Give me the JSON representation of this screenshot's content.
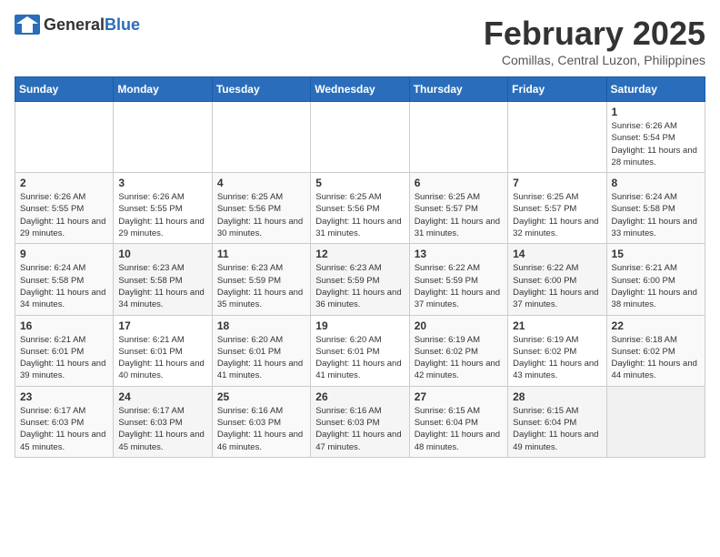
{
  "header": {
    "logo_general": "General",
    "logo_blue": "Blue",
    "month_year": "February 2025",
    "location": "Comillas, Central Luzon, Philippines"
  },
  "weekdays": [
    "Sunday",
    "Monday",
    "Tuesday",
    "Wednesday",
    "Thursday",
    "Friday",
    "Saturday"
  ],
  "weeks": [
    [
      {
        "day": "",
        "sunrise": "",
        "sunset": "",
        "daylight": ""
      },
      {
        "day": "",
        "sunrise": "",
        "sunset": "",
        "daylight": ""
      },
      {
        "day": "",
        "sunrise": "",
        "sunset": "",
        "daylight": ""
      },
      {
        "day": "",
        "sunrise": "",
        "sunset": "",
        "daylight": ""
      },
      {
        "day": "",
        "sunrise": "",
        "sunset": "",
        "daylight": ""
      },
      {
        "day": "",
        "sunrise": "",
        "sunset": "",
        "daylight": ""
      },
      {
        "day": "1",
        "sunrise": "6:26 AM",
        "sunset": "5:54 PM",
        "daylight": "11 hours and 28 minutes."
      }
    ],
    [
      {
        "day": "2",
        "sunrise": "6:26 AM",
        "sunset": "5:55 PM",
        "daylight": "11 hours and 29 minutes."
      },
      {
        "day": "3",
        "sunrise": "6:26 AM",
        "sunset": "5:55 PM",
        "daylight": "11 hours and 29 minutes."
      },
      {
        "day": "4",
        "sunrise": "6:25 AM",
        "sunset": "5:56 PM",
        "daylight": "11 hours and 30 minutes."
      },
      {
        "day": "5",
        "sunrise": "6:25 AM",
        "sunset": "5:56 PM",
        "daylight": "11 hours and 31 minutes."
      },
      {
        "day": "6",
        "sunrise": "6:25 AM",
        "sunset": "5:57 PM",
        "daylight": "11 hours and 31 minutes."
      },
      {
        "day": "7",
        "sunrise": "6:25 AM",
        "sunset": "5:57 PM",
        "daylight": "11 hours and 32 minutes."
      },
      {
        "day": "8",
        "sunrise": "6:24 AM",
        "sunset": "5:58 PM",
        "daylight": "11 hours and 33 minutes."
      }
    ],
    [
      {
        "day": "9",
        "sunrise": "6:24 AM",
        "sunset": "5:58 PM",
        "daylight": "11 hours and 34 minutes."
      },
      {
        "day": "10",
        "sunrise": "6:23 AM",
        "sunset": "5:58 PM",
        "daylight": "11 hours and 34 minutes."
      },
      {
        "day": "11",
        "sunrise": "6:23 AM",
        "sunset": "5:59 PM",
        "daylight": "11 hours and 35 minutes."
      },
      {
        "day": "12",
        "sunrise": "6:23 AM",
        "sunset": "5:59 PM",
        "daylight": "11 hours and 36 minutes."
      },
      {
        "day": "13",
        "sunrise": "6:22 AM",
        "sunset": "5:59 PM",
        "daylight": "11 hours and 37 minutes."
      },
      {
        "day": "14",
        "sunrise": "6:22 AM",
        "sunset": "6:00 PM",
        "daylight": "11 hours and 37 minutes."
      },
      {
        "day": "15",
        "sunrise": "6:21 AM",
        "sunset": "6:00 PM",
        "daylight": "11 hours and 38 minutes."
      }
    ],
    [
      {
        "day": "16",
        "sunrise": "6:21 AM",
        "sunset": "6:01 PM",
        "daylight": "11 hours and 39 minutes."
      },
      {
        "day": "17",
        "sunrise": "6:21 AM",
        "sunset": "6:01 PM",
        "daylight": "11 hours and 40 minutes."
      },
      {
        "day": "18",
        "sunrise": "6:20 AM",
        "sunset": "6:01 PM",
        "daylight": "11 hours and 41 minutes."
      },
      {
        "day": "19",
        "sunrise": "6:20 AM",
        "sunset": "6:01 PM",
        "daylight": "11 hours and 41 minutes."
      },
      {
        "day": "20",
        "sunrise": "6:19 AM",
        "sunset": "6:02 PM",
        "daylight": "11 hours and 42 minutes."
      },
      {
        "day": "21",
        "sunrise": "6:19 AM",
        "sunset": "6:02 PM",
        "daylight": "11 hours and 43 minutes."
      },
      {
        "day": "22",
        "sunrise": "6:18 AM",
        "sunset": "6:02 PM",
        "daylight": "11 hours and 44 minutes."
      }
    ],
    [
      {
        "day": "23",
        "sunrise": "6:17 AM",
        "sunset": "6:03 PM",
        "daylight": "11 hours and 45 minutes."
      },
      {
        "day": "24",
        "sunrise": "6:17 AM",
        "sunset": "6:03 PM",
        "daylight": "11 hours and 45 minutes."
      },
      {
        "day": "25",
        "sunrise": "6:16 AM",
        "sunset": "6:03 PM",
        "daylight": "11 hours and 46 minutes."
      },
      {
        "day": "26",
        "sunrise": "6:16 AM",
        "sunset": "6:03 PM",
        "daylight": "11 hours and 47 minutes."
      },
      {
        "day": "27",
        "sunrise": "6:15 AM",
        "sunset": "6:04 PM",
        "daylight": "11 hours and 48 minutes."
      },
      {
        "day": "28",
        "sunrise": "6:15 AM",
        "sunset": "6:04 PM",
        "daylight": "11 hours and 49 minutes."
      },
      {
        "day": "",
        "sunrise": "",
        "sunset": "",
        "daylight": ""
      }
    ]
  ]
}
